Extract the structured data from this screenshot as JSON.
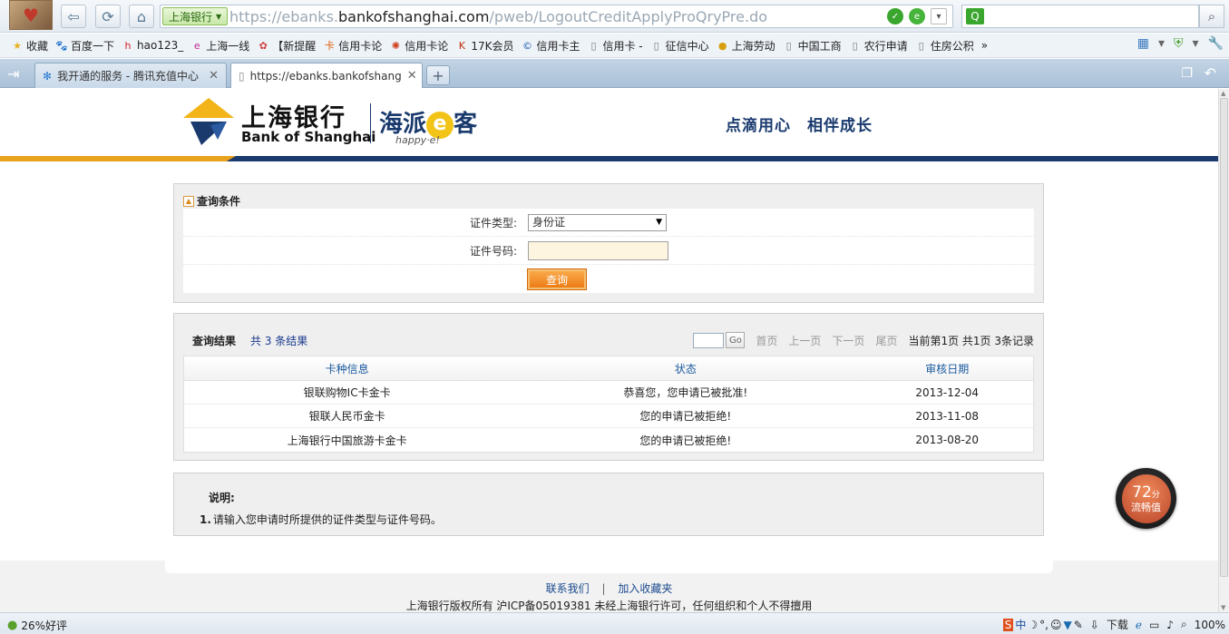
{
  "browser": {
    "url_badge": "上海银行",
    "url_prefix": "https://ebanks.",
    "url_domain": "bankofshanghai.com",
    "url_path": "/pweb/LogoutCreditApplyProQryPre.do",
    "bookmarks": [
      {
        "icon": "star-icon",
        "label": "收藏"
      },
      {
        "icon": "paw-icon",
        "label": "百度一下"
      },
      {
        "icon": "hao-icon",
        "label": "hao123_"
      },
      {
        "icon": "e-icon",
        "label": "上海一线"
      },
      {
        "icon": "flower-icon",
        "label": "【新提醒"
      },
      {
        "icon": "card-icon",
        "label": "信用卡论"
      },
      {
        "icon": "spin-icon",
        "label": "信用卡论"
      },
      {
        "icon": "k-icon",
        "label": "17K会员"
      },
      {
        "icon": "c-icon",
        "label": "信用卡主"
      },
      {
        "icon": "page-icon",
        "label": "信用卡 -"
      },
      {
        "icon": "page-icon",
        "label": "征信中心"
      },
      {
        "icon": "coin-icon",
        "label": "上海劳动"
      },
      {
        "icon": "page-icon",
        "label": "中国工商"
      },
      {
        "icon": "page-icon",
        "label": "农行申请"
      },
      {
        "icon": "page-icon",
        "label": "住房公积"
      }
    ],
    "tabs": [
      {
        "label": "我开通的服务 - 腾讯充值中心"
      },
      {
        "label": "https://ebanks.bankofshang"
      }
    ],
    "status": {
      "rating": "26%好评",
      "download": "下载",
      "zoom": "100%",
      "ime": "中"
    }
  },
  "header": {
    "logo_cn": "上海银行",
    "logo_en": "Bank of Shanghai",
    "brand_prefix": "海派",
    "brand_e": "e",
    "brand_suffix": "客",
    "brand_sub": "happy·e!",
    "slogan": "点滴用心　相伴成长"
  },
  "query": {
    "title": "查询条件",
    "id_type_label": "证件类型:",
    "id_type_value": "身份证",
    "id_number_label": "证件号码:",
    "id_number_value": "",
    "submit_label": "查询"
  },
  "results": {
    "title": "查询结果",
    "count_text": "共 3 条结果",
    "pager": {
      "go_label": "Go",
      "first": "首页",
      "prev": "上一页",
      "next": "下一页",
      "last": "尾页",
      "info": "当前第1页 共1页 3条记录"
    },
    "columns": [
      "卡种信息",
      "状态",
      "审核日期"
    ],
    "rows": [
      [
        "银联购物IC卡金卡",
        "恭喜您，您申请已被批准!",
        "2013-12-04"
      ],
      [
        "银联人民币金卡",
        "您的申请已被拒绝!",
        "2013-11-08"
      ],
      [
        "上海银行中国旅游卡金卡",
        "您的申请已被拒绝!",
        "2013-08-20"
      ]
    ]
  },
  "notes": {
    "title": "说明:",
    "items": [
      {
        "num": "1.",
        "text": "请输入您申请时所提供的证件类型与证件号码。"
      }
    ]
  },
  "footer": {
    "contact": "联系我们",
    "separator": "|",
    "bookmark": "加入收藏夹",
    "copyright": "上海银行版权所有  沪ICP备05019381 未经上海银行许可，任何组织和个人不得擅用"
  },
  "float_widget": {
    "score": "72",
    "unit": "分",
    "label": "流畅值"
  },
  "colors": {
    "brand_blue": "#1a3a6e",
    "brand_gold": "#e8a21c",
    "button_orange": "#ec7c14"
  }
}
